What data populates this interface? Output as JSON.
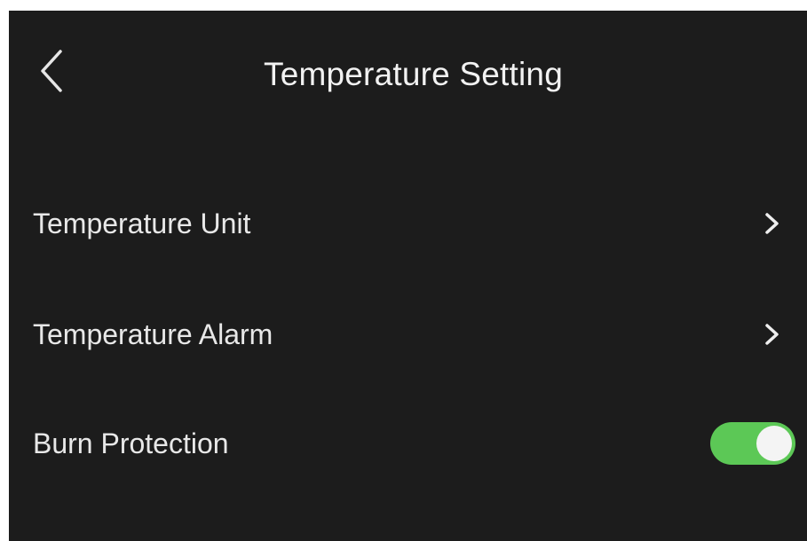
{
  "header": {
    "back_icon": "chevron-left-icon",
    "title": "Temperature Setting"
  },
  "settings": {
    "items": [
      {
        "label": "Temperature Unit",
        "control": "chevron-right-icon"
      },
      {
        "label": "Temperature Alarm",
        "control": "chevron-right-icon"
      },
      {
        "label": "Burn Protection",
        "control": "toggle",
        "enabled": true
      }
    ]
  },
  "colors": {
    "background": "#1c1c1c",
    "text": "#e8e8e8",
    "toggle_on": "#5cc856",
    "toggle_off": "#5a5a5a",
    "toggle_knob": "#f4f4f4"
  }
}
